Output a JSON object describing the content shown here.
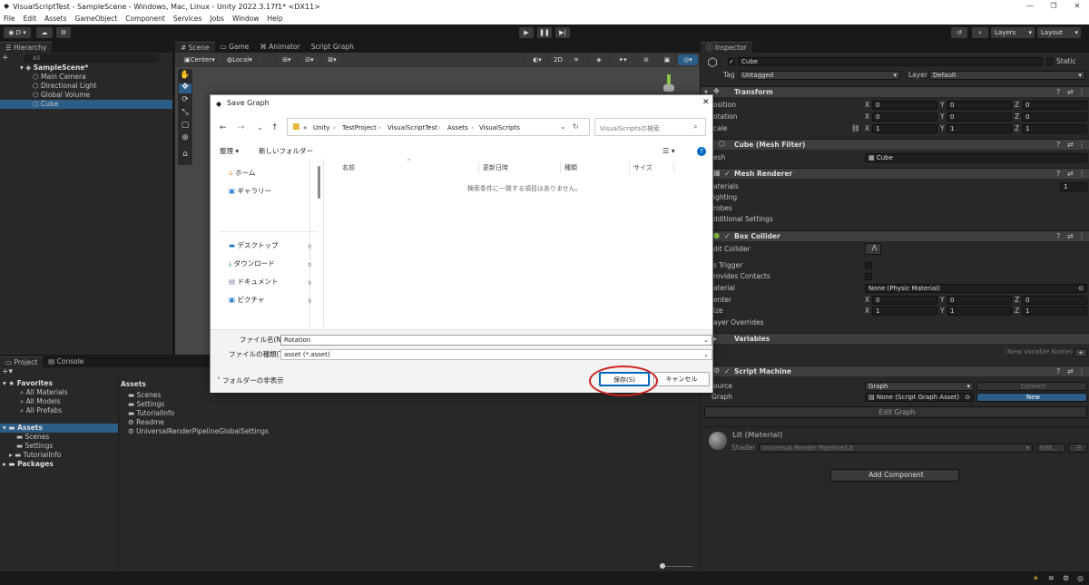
{
  "window": {
    "title": "VisualScriptTest - SampleScene - Windows, Mac, Linux - Unity 2022.3.17f1* <DX11>",
    "controls": [
      "—",
      "❐",
      "✕"
    ]
  },
  "menu": [
    "File",
    "Edit",
    "Assets",
    "GameObject",
    "Component",
    "Services",
    "Jobs",
    "Window",
    "Help"
  ],
  "toolbar": {
    "account": "D",
    "layers": "Layers",
    "layout": "Layout"
  },
  "hierarchy": {
    "tab": "Hierarchy",
    "search_placeholder": "All",
    "items": [
      {
        "label": "SampleScene*"
      },
      {
        "label": "Main Camera"
      },
      {
        "label": "Directional Light"
      },
      {
        "label": "Global Volume"
      },
      {
        "label": "Cube"
      }
    ]
  },
  "scene": {
    "tabs": [
      "Scene",
      "Game",
      "Animator",
      "Script Graph"
    ],
    "pivot": "Center",
    "space": "Local",
    "mode2d": "2D"
  },
  "dialog": {
    "title": "Save Graph",
    "path": [
      "«",
      "Unity",
      "TestProject",
      "VisualScriptTest",
      "Assets",
      "VisualScripts"
    ],
    "search_placeholder": "VisualScriptsの検索",
    "organize": "整理",
    "new_folder": "新しいフォルダー",
    "nav": [
      {
        "label": "ホーム"
      },
      {
        "label": "ギャラリー"
      },
      {
        "label": "デスクトップ"
      },
      {
        "label": "ダウンロード"
      },
      {
        "label": "ドキュメント"
      },
      {
        "label": "ピクチャ"
      }
    ],
    "columns": [
      "名前",
      "更新日時",
      "種類",
      "サイズ"
    ],
    "empty_message": "検索条件に一致する項目はありません。",
    "filename_label": "ファイル名(N):",
    "filename_value": "Rotation",
    "filetype_label": "ファイルの種類(T):",
    "filetype_value": "asset (*.asset)",
    "hide_folders": "フォルダーの非表示",
    "save": "保存(S)",
    "cancel": "キャンセル"
  },
  "project": {
    "tabs": [
      "Project",
      "Console"
    ],
    "favorites": {
      "label": "Favorites",
      "items": [
        "All Materials",
        "All Models",
        "All Prefabs"
      ]
    },
    "assets": {
      "label": "Assets",
      "items": [
        "Scenes",
        "Settings",
        "TutorialInfo"
      ]
    },
    "packages": "Packages",
    "breadcrumb": "Assets",
    "files": [
      "Scenes",
      "Settings",
      "TutorialInfo",
      "Readme",
      "UniversalRenderPipelineGlobalSettings"
    ]
  },
  "inspector": {
    "tab": "Inspector",
    "object_name": "Cube",
    "static": "Static",
    "tag_label": "Tag",
    "tag_value": "Untagged",
    "layer_label": "Layer",
    "layer_value": "Default",
    "transform": {
      "name": "Transform",
      "rows": [
        {
          "label": "osition",
          "x": "0",
          "y": "0",
          "z": "0"
        },
        {
          "label": "otation",
          "x": "0",
          "y": "0",
          "z": "0"
        },
        {
          "label": "cale",
          "x": "1",
          "y": "1",
          "z": "1"
        }
      ]
    },
    "mesh_filter": {
      "name": "Cube (Mesh Filter)",
      "mesh_label": "esh",
      "mesh_value": "Cube"
    },
    "mesh_renderer": {
      "name": "Mesh Renderer",
      "rows": [
        "aterials",
        "ighting",
        "robes",
        "dditional Settings"
      ],
      "materials_count": "1"
    },
    "box_collider": {
      "name": "Box Collider",
      "edit_label": "dit Collider",
      "trigger_label": "s Trigger",
      "contacts_label": "rovides Contacts",
      "material_label": "aterial",
      "material_value": "None (Physic Material)",
      "center_label": "enter",
      "center": {
        "x": "0",
        "y": "0",
        "z": "0"
      },
      "size_label": "ize",
      "size": {
        "x": "1",
        "y": "1",
        "z": "1"
      },
      "overrides_label": "ayer Overrides"
    },
    "variables": {
      "name": "Variables",
      "new_placeholder": "(New Variable Name)",
      "add": "+"
    },
    "script_machine": {
      "name": "Script Machine",
      "source_label": "ource",
      "source_value": "Graph",
      "convert": "Convert",
      "graph_label": "Graph",
      "graph_value": "None (Script Graph Asset)",
      "new_button": "New",
      "edit_button": "Edit Graph"
    },
    "material": {
      "name": "Lit (Material)",
      "shader_label": "Shader",
      "shader_value": "Universal Render Pipeline/Lit",
      "edit": "Edit..."
    },
    "add_component": "Add Component"
  },
  "colors": {
    "accent": "#2c5d87",
    "highlight": "#cc1f1f",
    "save_border": "#0067c0"
  }
}
